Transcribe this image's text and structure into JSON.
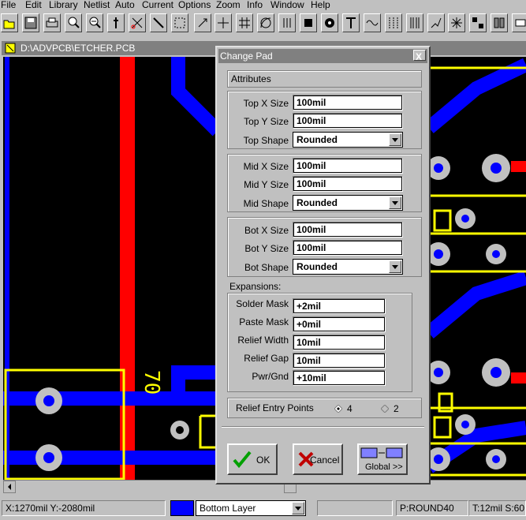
{
  "menu": [
    "File",
    "Edit",
    "Library",
    "Netlist",
    "Auto",
    "Current",
    "Options",
    "Zoom",
    "Info",
    "Window",
    "Help"
  ],
  "toolbar_icons": [
    "open-icon",
    "save-icon",
    "print-icon",
    "zoom-icon",
    "zoom-out-icon",
    "probe-icon",
    "cut-icon",
    "draw-icon",
    "select-icon",
    "move-icon",
    "grid-icon",
    "arc-icon",
    "line-icon",
    "square-icon",
    "circle-icon",
    "text-icon",
    "wave-icon",
    "bus-icon",
    "route-icon",
    "star-icon",
    "parts-icon",
    "book-icon",
    "component-icon"
  ],
  "document": {
    "title": "D:\\ADVPCB\\ETCHER.PCB"
  },
  "canvas_labels": {
    "ref_70": "70"
  },
  "dialog": {
    "title": "Change Pad",
    "close": "X",
    "attributes_label": "Attributes",
    "top": {
      "x_label": "Top X Size",
      "x_value": "100mil",
      "y_label": "Top Y Size",
      "y_value": "100mil",
      "shape_label": "Top Shape",
      "shape_value": "Rounded"
    },
    "mid": {
      "x_label": "Mid X Size",
      "x_value": "100mil",
      "y_label": "Mid Y Size",
      "y_value": "100mil",
      "shape_label": "Mid Shape",
      "shape_value": "Rounded"
    },
    "bot": {
      "x_label": "Bot X Size",
      "x_value": "100mil",
      "y_label": "Bot Y Size",
      "y_value": "100mil",
      "shape_label": "Bot Shape",
      "shape_value": "Rounded"
    },
    "expansions_label": "Expansions:",
    "solder_label": "Solder Mask",
    "solder_value": "+2mil",
    "paste_label": "Paste Mask",
    "paste_value": "+0mil",
    "relief_width_label": "Relief Width",
    "relief_width_value": "10mil",
    "relief_gap_label": "Relief Gap",
    "relief_gap_value": "10mil",
    "pwr_label": "Pwr/Gnd",
    "pwr_value": "+10mil",
    "relief_entry_label": "Relief Entry Points",
    "relief_opt1": "4",
    "relief_opt2": "2",
    "ok": "OK",
    "cancel": "Cancel",
    "global": "Global >>"
  },
  "status": {
    "coords": "X:1270mil Y:-2080mil",
    "layer": "Bottom Layer",
    "pad": "P:ROUND40",
    "track": "T:12mil S:60"
  },
  "colors": {
    "track_red": "#ff0000",
    "track_blue": "#0000ff",
    "silk_yellow": "#ffff00",
    "pad_gray": "#c0c0c0"
  }
}
